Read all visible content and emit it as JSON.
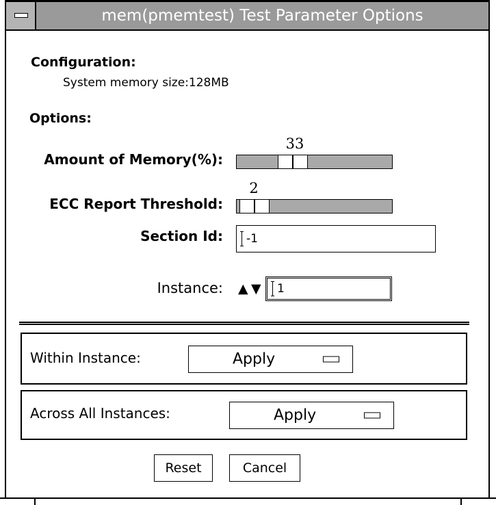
{
  "window": {
    "title": "mem(pmemtest) Test Parameter Options"
  },
  "configuration": {
    "heading": "Configuration:",
    "memory_size_text": "System memory size:128MB"
  },
  "options": {
    "heading": "Options:",
    "amount_of_memory": {
      "label": "Amount of Memory(%):",
      "value": "33",
      "fraction": 0.33
    },
    "ecc_report_threshold": {
      "label": "ECC Report Threshold:",
      "value": "2",
      "fraction": 0.02
    },
    "section_id": {
      "label": "Section Id:",
      "value": "-1"
    },
    "instance": {
      "label": "Instance:",
      "value": "1",
      "up_glyph": "▲",
      "down_glyph": "▼"
    }
  },
  "within_instance": {
    "label": "Within Instance:",
    "button_label": "Apply"
  },
  "across_all_instances": {
    "label": "Across All Instances:",
    "button_label": "Apply"
  },
  "buttons": {
    "reset": "Reset",
    "cancel": "Cancel"
  },
  "colors": {
    "titlebar": "#9a9a9a",
    "slider_track": "#a9a9a9"
  },
  "icons": {
    "window_menu": "window-menu-icon",
    "menu_indicator": "option-menu-indicator-icon"
  }
}
